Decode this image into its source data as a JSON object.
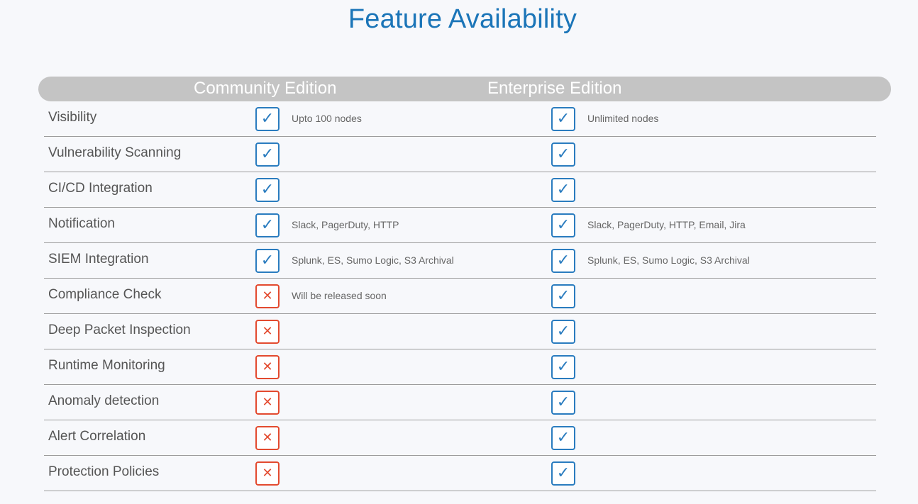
{
  "title": "Feature Availability",
  "colors": {
    "title": "#1b75b8",
    "header_bar": "#c4c4c4",
    "check": "#2a7cbf",
    "cross": "#e34a2f"
  },
  "header": {
    "community": "Community Edition",
    "enterprise": "Enterprise Edition"
  },
  "icons": {
    "check_glyph": "✓",
    "cross_glyph": "✕"
  },
  "rows": [
    {
      "feature": "Visibility",
      "community": {
        "available": true,
        "note": "Upto 100 nodes"
      },
      "enterprise": {
        "available": true,
        "note": "Unlimited nodes"
      }
    },
    {
      "feature": "Vulnerability Scanning",
      "community": {
        "available": true,
        "note": ""
      },
      "enterprise": {
        "available": true,
        "note": ""
      }
    },
    {
      "feature": "CI/CD Integration",
      "community": {
        "available": true,
        "note": ""
      },
      "enterprise": {
        "available": true,
        "note": ""
      }
    },
    {
      "feature": "Notification",
      "community": {
        "available": true,
        "note": "Slack, PagerDuty, HTTP"
      },
      "enterprise": {
        "available": true,
        "note": "Slack, PagerDuty, HTTP, Email, Jira"
      }
    },
    {
      "feature": "SIEM Integration",
      "community": {
        "available": true,
        "note": "Splunk, ES, Sumo Logic, S3 Archival"
      },
      "enterprise": {
        "available": true,
        "note": "Splunk, ES, Sumo Logic, S3 Archival"
      }
    },
    {
      "feature": "Compliance Check",
      "community": {
        "available": false,
        "note": "Will be released soon"
      },
      "enterprise": {
        "available": true,
        "note": ""
      }
    },
    {
      "feature": "Deep Packet Inspection",
      "community": {
        "available": false,
        "note": ""
      },
      "enterprise": {
        "available": true,
        "note": ""
      }
    },
    {
      "feature": "Runtime Monitoring",
      "community": {
        "available": false,
        "note": ""
      },
      "enterprise": {
        "available": true,
        "note": ""
      }
    },
    {
      "feature": "Anomaly detection",
      "community": {
        "available": false,
        "note": ""
      },
      "enterprise": {
        "available": true,
        "note": ""
      }
    },
    {
      "feature": "Alert Correlation",
      "community": {
        "available": false,
        "note": ""
      },
      "enterprise": {
        "available": true,
        "note": ""
      }
    },
    {
      "feature": "Protection Policies",
      "community": {
        "available": false,
        "note": ""
      },
      "enterprise": {
        "available": true,
        "note": ""
      }
    }
  ]
}
